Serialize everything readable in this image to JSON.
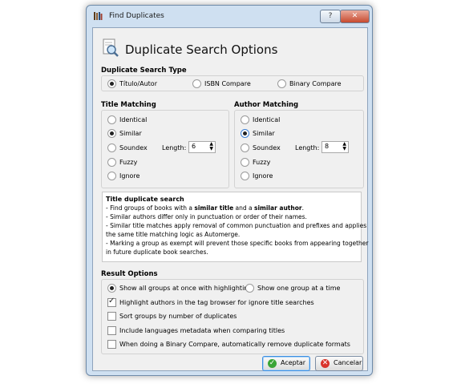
{
  "window": {
    "title": "Find Duplicates",
    "help_label": "?",
    "close_label": "✕"
  },
  "header": {
    "title": "Duplicate Search Options"
  },
  "search_type": {
    "label": "Duplicate Search Type",
    "options": [
      "Título/Autor",
      "ISBN Compare",
      "Binary Compare"
    ],
    "selected": "Título/Autor"
  },
  "title_matching": {
    "label": "Title Matching",
    "options": [
      "Identical",
      "Similar",
      "Soundex",
      "Fuzzy",
      "Ignore"
    ],
    "selected": "Similar",
    "length_label": "Length:",
    "length_value": "6"
  },
  "author_matching": {
    "label": "Author Matching",
    "options": [
      "Identical",
      "Similar",
      "Soundex",
      "Fuzzy",
      "Ignore"
    ],
    "selected": "Similar",
    "length_label": "Length:",
    "length_value": "8"
  },
  "info": {
    "heading": "Title duplicate search",
    "line1a": "- Find groups of books with a ",
    "line1b": "similar title",
    "line1c": " and a ",
    "line1d": "similar author",
    "line1e": ".",
    "line2": "- Similar authors differ only in punctuation or order of their names.",
    "line3": "- Similar title matches apply removal of common punctuation and prefixes and applies",
    "line4": "the same title matching logic as Automerge.",
    "line5": "- Marking a group as exempt will prevent those specific books from appearing together",
    "line6": "in future duplicate book searches."
  },
  "result_options": {
    "label": "Result Options",
    "show_all": "Show all groups at once with highlighting",
    "show_one": "Show one group at a time",
    "highlight_authors": "Highlight authors in the tag browser for ignore title searches",
    "sort_groups": "Sort groups by number of duplicates",
    "include_languages": "Include languages metadata when comparing titles",
    "binary_remove": "When doing a Binary Compare, automatically remove duplicate formats"
  },
  "buttons": {
    "ok": "Aceptar",
    "cancel": "Cancelar"
  }
}
